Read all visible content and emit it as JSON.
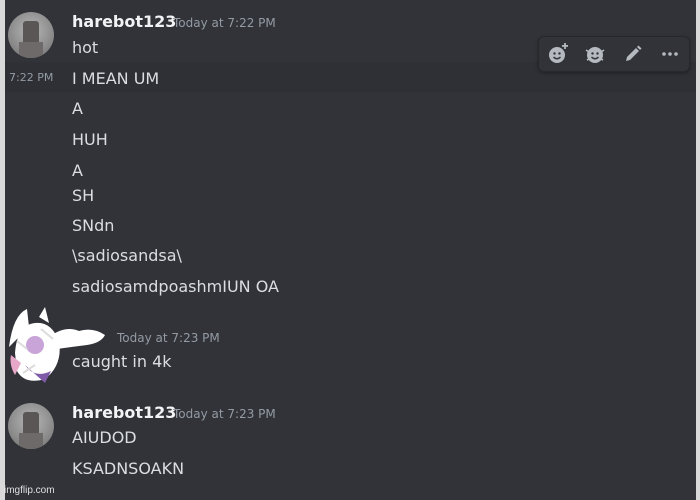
{
  "messages": [
    {
      "author": "harebot123",
      "timestamp": "Today at 7:22 PM",
      "lines": [
        "hot",
        "I MEAN UM",
        "A",
        "HUH",
        "A",
        "SH",
        "SNdn",
        "\\sadiosandsa\\",
        "sadiosamdpoashmIUN OA"
      ],
      "hover_timestamp": "7:22 PM"
    },
    {
      "author": "",
      "timestamp": "Today at 7:23 PM",
      "lines": [
        "caught in 4k"
      ]
    },
    {
      "author": "harebot123",
      "timestamp": "Today at 7:23 PM",
      "lines": [
        "AIUDOD",
        "KSADNSOAKN"
      ]
    }
  ],
  "toolbar": {
    "icons": [
      "add-reaction-icon",
      "super-reaction-icon",
      "edit-icon",
      "more-icon"
    ]
  },
  "watermark": "imgflip.com",
  "colors": {
    "background": "#313338",
    "author": "#f2f3f5",
    "message_text": "#dbdee1",
    "timestamp": "#949ba4"
  }
}
